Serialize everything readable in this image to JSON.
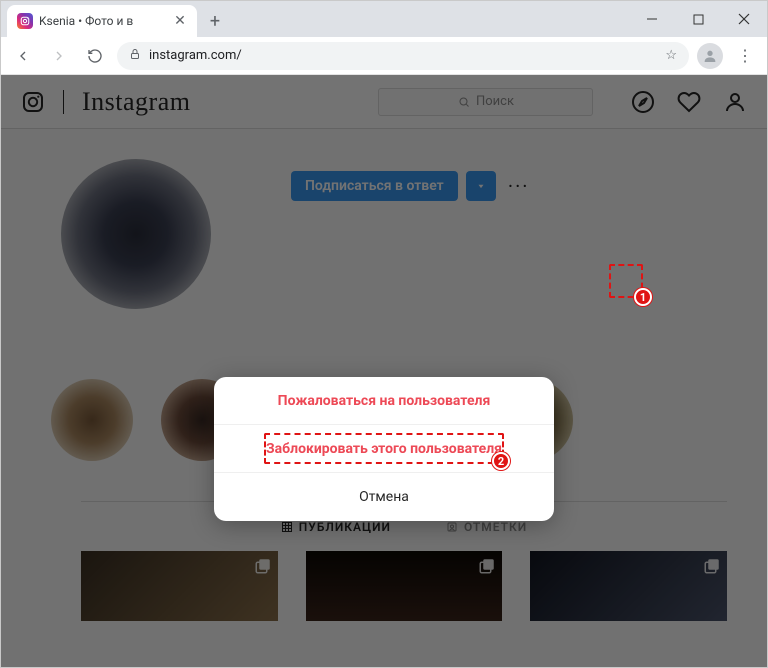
{
  "browser": {
    "tab_title": "Ksenia            • Фото и в",
    "url": "instagram.com/"
  },
  "ig": {
    "wordmark": "Instagram",
    "search_placeholder": "Поиск",
    "follow_label": "Подписаться в ответ",
    "tabs": {
      "posts": "ПУБЛИКАЦИИ",
      "tagged": "ОТМЕТКИ"
    }
  },
  "modal": {
    "report": "Пожаловаться на пользователя",
    "block": "Заблокировать этого пользователя",
    "cancel": "Отмена"
  },
  "annot": {
    "n1": "1",
    "n2": "2"
  }
}
